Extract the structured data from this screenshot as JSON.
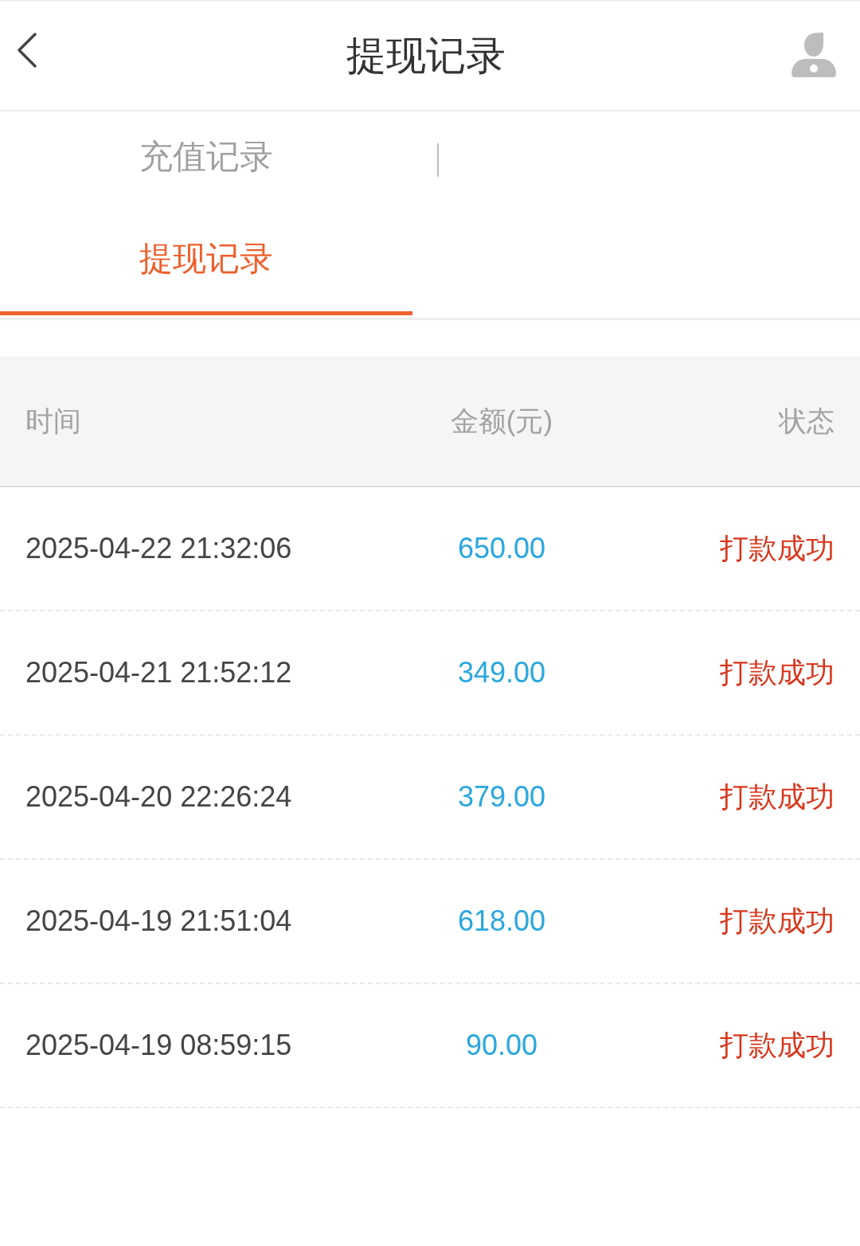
{
  "header": {
    "title": "提现记录"
  },
  "tabs": [
    {
      "label": "充值记录",
      "selected": false
    },
    {
      "label": "提现记录",
      "selected": true
    }
  ],
  "table": {
    "columns": [
      "时间",
      "金额(元)",
      "状态"
    ],
    "rows": [
      {
        "time": "2025-04-22 21:32:06",
        "amount": "650.00",
        "status": "打款成功"
      },
      {
        "time": "2025-04-21 21:52:12",
        "amount": "349.00",
        "status": "打款成功"
      },
      {
        "time": "2025-04-20 22:26:24",
        "amount": "379.00",
        "status": "打款成功"
      },
      {
        "time": "2025-04-19 21:51:04",
        "amount": "618.00",
        "status": "打款成功"
      },
      {
        "time": "2025-04-19 08:59:15",
        "amount": "90.00",
        "status": "打款成功"
      }
    ]
  }
}
